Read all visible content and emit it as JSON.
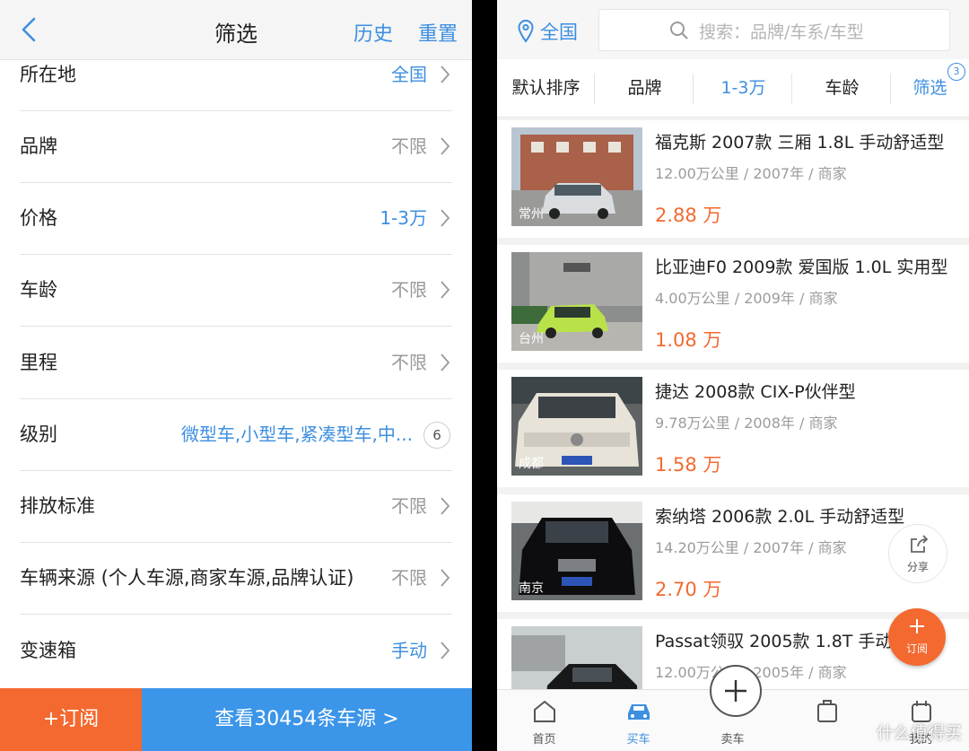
{
  "filter": {
    "title": "筛选",
    "history": "历史",
    "reset": "重置",
    "rows": [
      {
        "label": "所在地",
        "value": "全国",
        "highlight": true
      },
      {
        "label": "品牌",
        "value": "不限",
        "highlight": false
      },
      {
        "label": "价格",
        "value": "1-3万",
        "highlight": true
      },
      {
        "label": "车龄",
        "value": "不限",
        "highlight": false
      },
      {
        "label": "里程",
        "value": "不限",
        "highlight": false
      },
      {
        "label": "级别",
        "value": "微型车,小型车,紧凑型车,中...",
        "highlight": true,
        "badge": "6"
      },
      {
        "label": "排放标准",
        "value": "不限",
        "highlight": false
      },
      {
        "label": "车辆来源 (个人车源,商家车源,品牌认证)",
        "value": "不限",
        "highlight": false
      },
      {
        "label": "变速箱",
        "value": "手动",
        "highlight": true
      }
    ],
    "subscribe_button": "+订阅",
    "view_button": "查看30454条车源 >"
  },
  "listing": {
    "location": "全国",
    "search_placeholder": "搜索：品牌/车系/车型",
    "sort_tabs": [
      "默认排序",
      "品牌",
      "1-3万",
      "车龄",
      "筛选"
    ],
    "filter_count": "3",
    "cars": [
      {
        "title": "福克斯 2007款 三厢 1.8L 手动舒适型",
        "meta": "12.00万公里 / 2007年 / 商家",
        "price": "2.88 万",
        "city": "常州"
      },
      {
        "title": "比亚迪F0 2009款 爱国版 1.0L 实用型",
        "meta": "4.00万公里 / 2009年 / 商家",
        "price": "1.08 万",
        "city": "台州"
      },
      {
        "title": "捷达 2008款 CIX-P伙伴型",
        "meta": "9.78万公里 / 2008年 / 商家",
        "price": "1.58 万",
        "city": "成都"
      },
      {
        "title": "索纳塔 2006款 2.0L 手动舒适型",
        "meta": "14.20万公里 / 2007年 / 商家",
        "price": "2.70 万",
        "city": "南京"
      },
      {
        "title": "Passat领驭 2005款 1.8T 手动舒适型",
        "meta": "12.00万公里 / 2005年 / 商家",
        "price": "",
        "city": ""
      }
    ],
    "share_label": "分享",
    "subscribe_fab": "订阅",
    "tabs": [
      "首页",
      "买车",
      "卖车",
      "",
      "我的"
    ]
  },
  "watermark": "什么值得买",
  "colors": {
    "accent": "#3d8fe0",
    "orange": "#f4692f"
  }
}
